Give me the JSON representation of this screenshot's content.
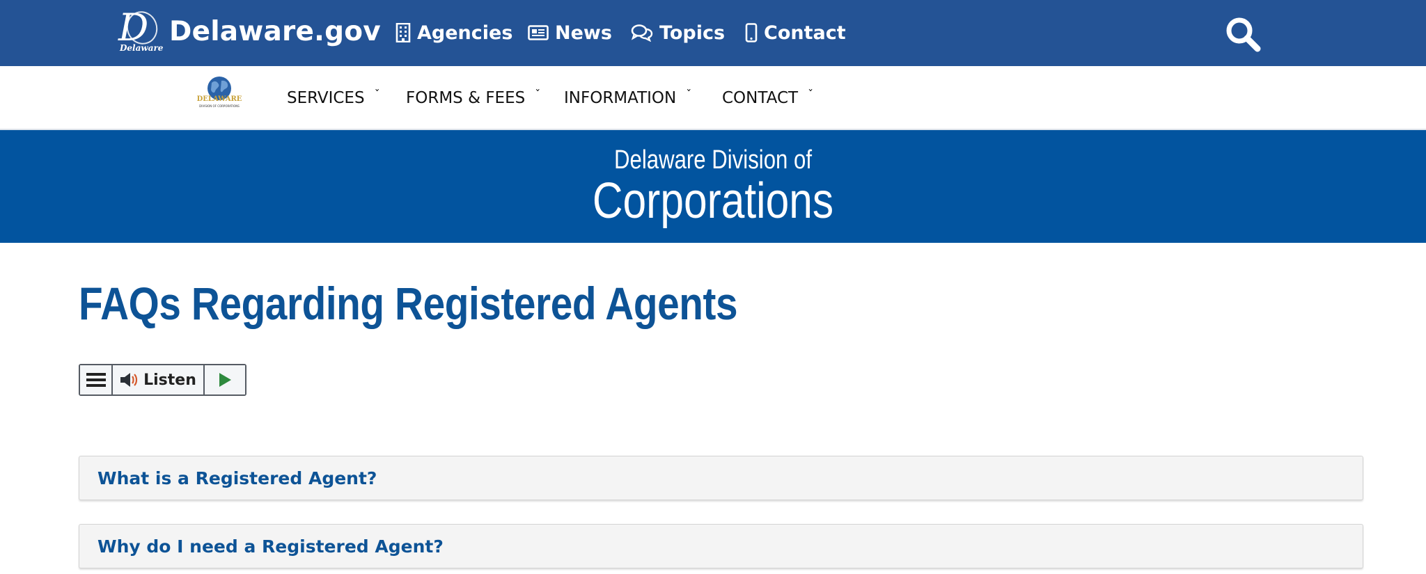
{
  "header": {
    "logo_glyph": "D",
    "logo_script": "Delaware",
    "site_name": "Delaware.gov",
    "nav": [
      {
        "label": "Agencies",
        "icon": "building-icon"
      },
      {
        "label": "News",
        "icon": "newspaper-icon"
      },
      {
        "label": "Topics",
        "icon": "chat-bubbles-icon"
      },
      {
        "label": "Contact",
        "icon": "mobile-phone-icon"
      }
    ],
    "search_icon": "search-icon",
    "background_color": "#245395"
  },
  "division_nav": {
    "logo_text": "DELAWARE",
    "logo_subtext": "DIVISION OF CORPORATIONS",
    "items": [
      {
        "label": "SERVICES",
        "caret": "ˇ"
      },
      {
        "label": "FORMS & FEES",
        "caret": "ˇ"
      },
      {
        "label": "INFORMATION",
        "caret": "ˇ"
      },
      {
        "label": "CONTACT",
        "caret": "ˇ"
      }
    ]
  },
  "banner": {
    "subtitle": "Delaware Division of",
    "title": "Corporations",
    "background_color": "#02549f"
  },
  "main": {
    "page_title": "FAQs Regarding Registered Agents",
    "listen_widget": {
      "label": "Listen",
      "menu_icon": "hamburger-icon",
      "speaker_icon": "speaker-icon",
      "play_icon": "play-icon"
    },
    "faqs": [
      {
        "question": "What is a Registered Agent?"
      },
      {
        "question": "Why do I need a Registered Agent?"
      }
    ],
    "accent_color": "#0d5396"
  }
}
